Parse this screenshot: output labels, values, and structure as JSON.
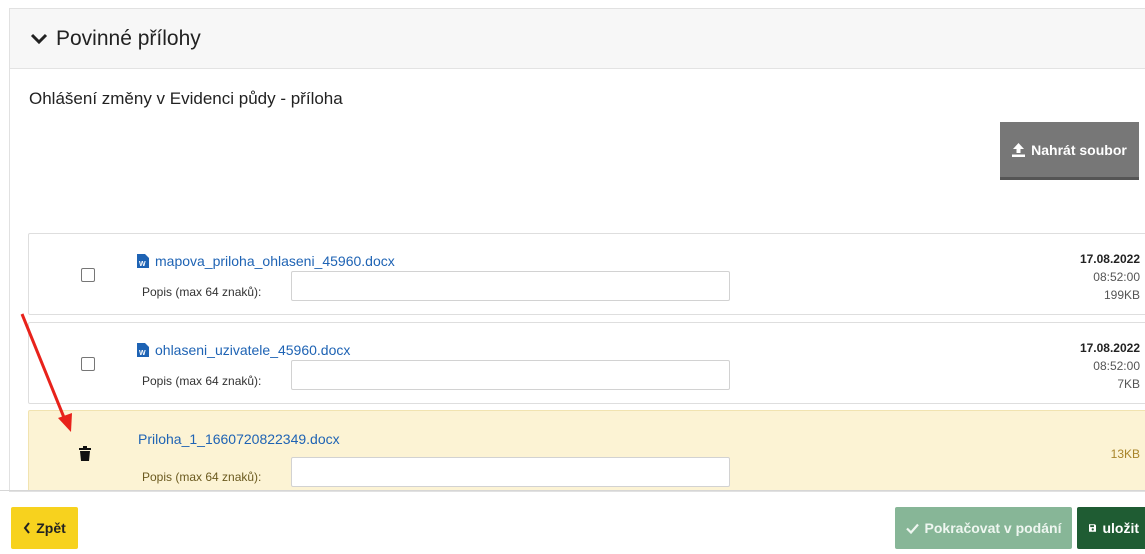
{
  "section": {
    "title": "Povinné přílohy",
    "subtitle": "Ohlášení změny v Evidenci půdy - příloha"
  },
  "upload_button": {
    "label": "Nahrát soubor",
    "icon": "upload-icon"
  },
  "files": [
    {
      "name": "mapova_priloha_ohlaseni_45960.docx",
      "desc_label": "Popis (max 64 znaků):",
      "desc_value": "",
      "date": "17.08.2022",
      "time": "08:52:00",
      "size": "199KB",
      "control": "checkbox"
    },
    {
      "name": "ohlaseni_uzivatele_45960.docx",
      "desc_label": "Popis (max 64 znaků):",
      "desc_value": "",
      "date": "17.08.2022",
      "time": "08:52:00",
      "size": "7KB",
      "control": "checkbox"
    },
    {
      "name": "Priloha_1_1660720822349.docx",
      "desc_label": "Popis (max 64 znaků):",
      "desc_value": "",
      "size": "13KB",
      "control": "trash-icon",
      "highlighted": true
    }
  ],
  "footer": {
    "back_label": "Zpět",
    "continue_label": "Pokračovat v podání",
    "save_label": "uložit"
  },
  "colors": {
    "link": "#1e63b4",
    "highlight_row": "#fcf3d4",
    "back_button": "#f7d21e",
    "continue_button": "#87b697",
    "save_button": "#1f5c33",
    "upload_button": "#777777",
    "annotation_arrow": "#e8221b"
  }
}
